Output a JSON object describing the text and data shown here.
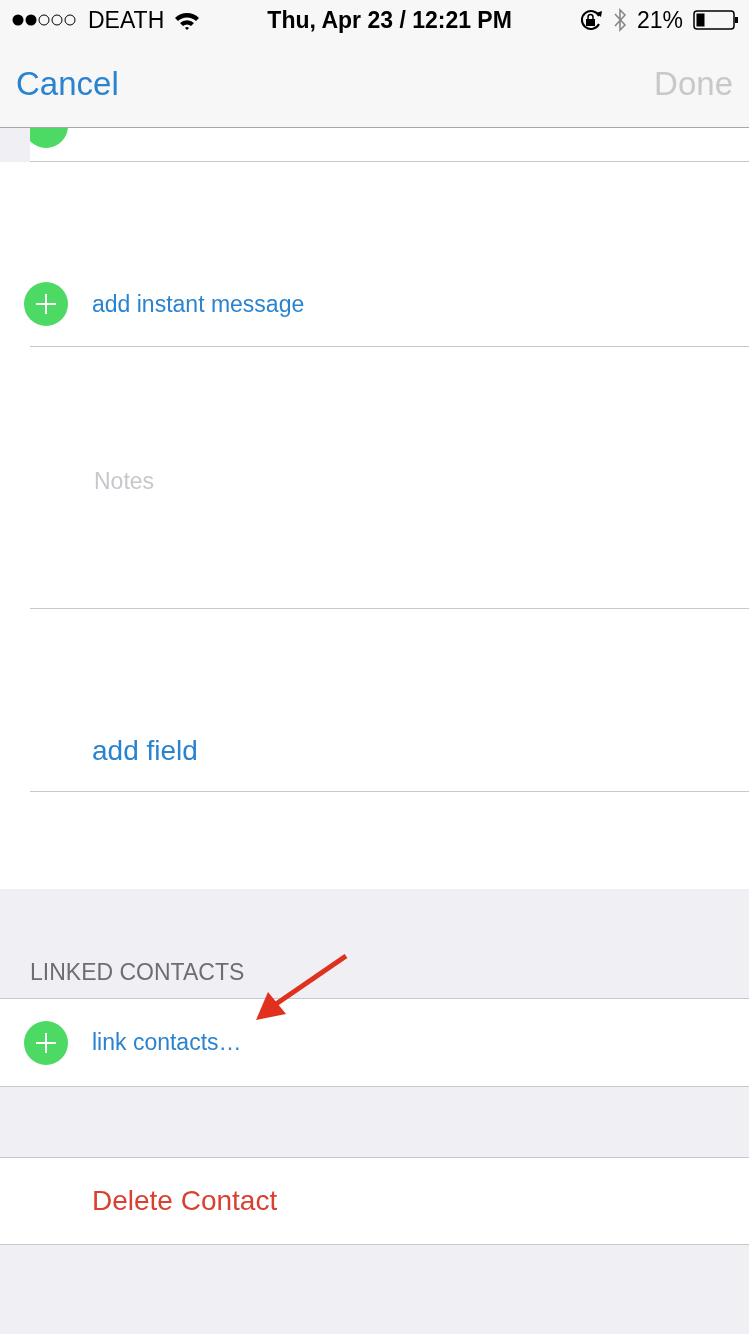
{
  "status_bar": {
    "carrier": "DEATH",
    "time": "Thu, Apr 23 / 12:21 PM",
    "battery": "21%"
  },
  "nav": {
    "cancel": "Cancel",
    "done": {
      "label": "Done",
      "disabled": true
    }
  },
  "form": [
    {
      "kind": "add",
      "label": "add instant message"
    },
    {
      "kind": "notes",
      "placeholder": "Notes"
    },
    {
      "kind": "action",
      "label": "add field"
    }
  ],
  "linked": {
    "header": "LINKED CONTACTS",
    "label": "link contacts…"
  },
  "delete": "Delete Contact"
}
